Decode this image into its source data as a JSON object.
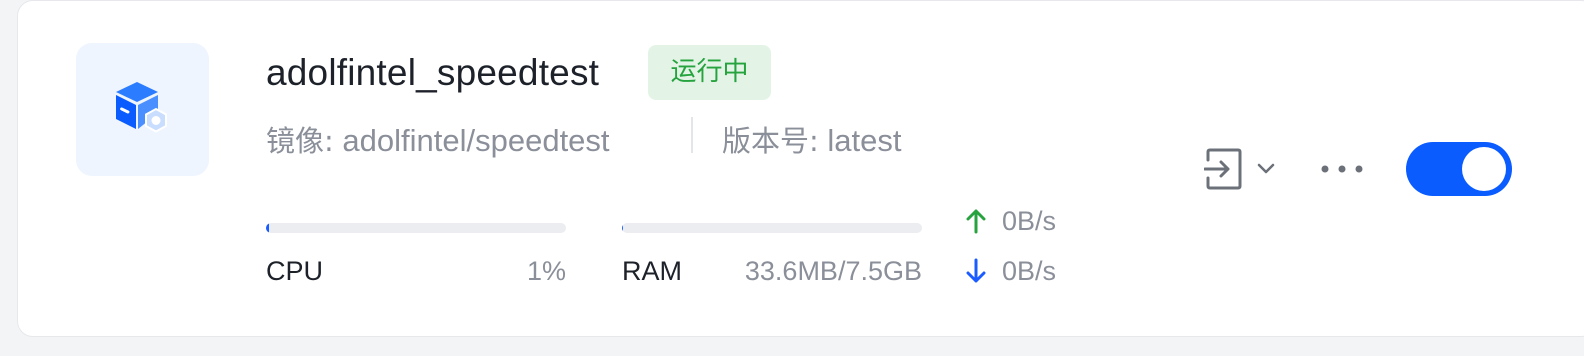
{
  "container": {
    "name": "adolfintel_speedtest",
    "status": "运行中",
    "image_label": "镜像:",
    "image_value": "adolfintel/speedtest",
    "version_label": "版本号:",
    "version_value": "latest",
    "enabled": true
  },
  "metrics": {
    "cpu": {
      "label": "CPU",
      "value": "1%",
      "fraction": 0.01
    },
    "ram": {
      "label": "RAM",
      "value": "33.6MB/7.5GB",
      "fraction": 0.0045
    },
    "network": {
      "upload": "0B/s",
      "download": "0B/s"
    }
  },
  "colors": {
    "accent": "#0a5cff",
    "status_text": "#26a33f",
    "status_bg": "#e3f4e6",
    "upload_arrow": "#26a33f",
    "download_arrow": "#1a5cff"
  },
  "icons": {
    "app": "container-box-icon",
    "enter": "enter-terminal-icon",
    "dropdown": "chevron-down-icon",
    "more": "more-horizontal-icon",
    "upload": "arrow-up-icon",
    "download": "arrow-down-icon"
  }
}
